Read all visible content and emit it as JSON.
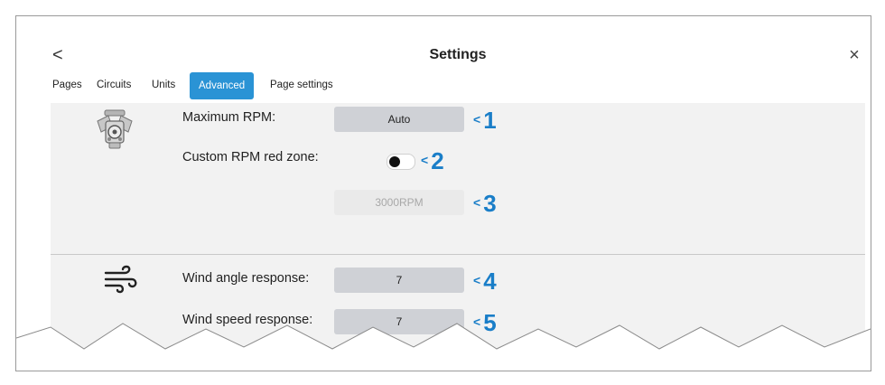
{
  "header": {
    "title": "Settings",
    "back_glyph": "<",
    "close_glyph": "×"
  },
  "tabs": [
    {
      "label": "Pages",
      "active": false
    },
    {
      "label": "Circuits",
      "active": false
    },
    {
      "label": "Units",
      "active": false
    },
    {
      "label": "Advanced",
      "active": true
    },
    {
      "label": "Page settings",
      "active": false
    }
  ],
  "engine_section": {
    "icon": "engine-icon",
    "max_rpm_label": "Maximum RPM:",
    "max_rpm_value": "Auto",
    "red_zone_label": "Custom RPM red zone:",
    "red_zone_enabled": false,
    "red_zone_value": "3000RPM"
  },
  "wind_section": {
    "icon": "wind-icon",
    "angle_label": "Wind angle response:",
    "angle_value": "7",
    "speed_label": "Wind speed response:",
    "speed_value": "7"
  },
  "callouts": [
    "1",
    "2",
    "3",
    "4",
    "5"
  ],
  "colors": {
    "accent": "#2a93d5",
    "callout": "#1a7ec8",
    "field": "#cfd1d6"
  }
}
